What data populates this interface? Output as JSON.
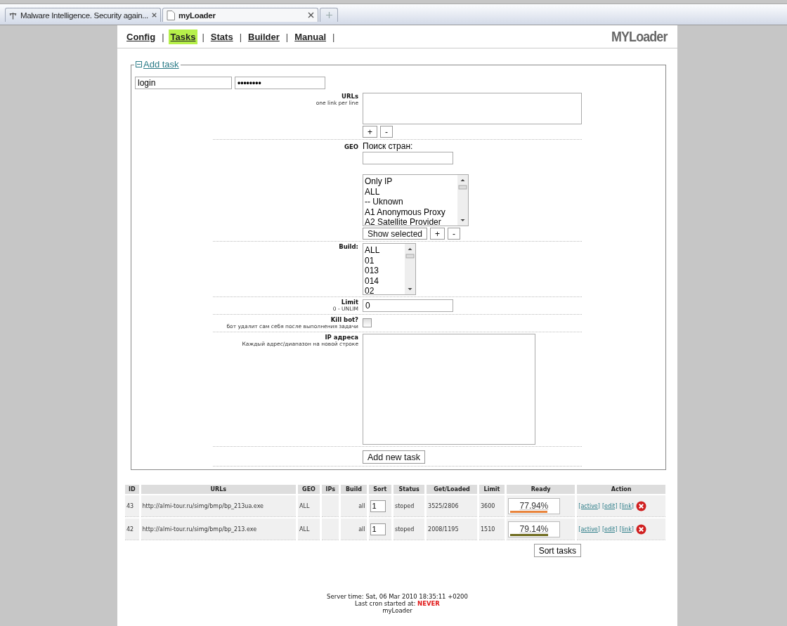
{
  "browser_tabs": [
    {
      "title": "Malware Intelligence. Security again...",
      "selected": false
    },
    {
      "title": "myLoader",
      "selected": true
    }
  ],
  "nav": [
    {
      "label": "Config",
      "selected": false,
      "separator": "|"
    },
    {
      "label": "Tasks",
      "selected": true,
      "separator": "|"
    },
    {
      "label": "Stats",
      "selected": false,
      "separator": "|"
    },
    {
      "label": "Builder",
      "selected": false,
      "separator": "|"
    },
    {
      "label": "Manual",
      "selected": false,
      "separator": "|"
    }
  ],
  "logo": "MYLoader",
  "add_task": {
    "legend": "Add task",
    "expanded": true,
    "login": "login",
    "password": "••••••••",
    "urls": {
      "label": "URLs",
      "hint": "one link per line",
      "buttons": [
        "+",
        "-"
      ]
    },
    "geo": {
      "label": "GEO",
      "search_label": "Поиск стран:",
      "options": [
        "Only IP",
        "ALL",
        "-- Uknown",
        "A1 Anonymous Proxy",
        "A2 Satellite Provider"
      ],
      "buttons": [
        "Show selected",
        "+",
        "-"
      ]
    },
    "build": {
      "label": "Build:",
      "options": [
        "ALL",
        "01",
        "013",
        "014",
        "02"
      ]
    },
    "limit": {
      "label": "Limit",
      "hint": "0 - UNLIM",
      "value": "0"
    },
    "kill_bot": {
      "label": "Kill bot?",
      "hint": "бот удалит сам себя после выполнения задачи",
      "checked": false
    },
    "ip": {
      "label": "IP адреса",
      "hint": "Каждый адрес/диапазон на новой строке"
    },
    "submit": "Add new task"
  },
  "table": {
    "columns": [
      "ID",
      "URLs",
      "GEO",
      "IPs",
      "Build",
      "Sort",
      "Status",
      "Get/Loaded",
      "Limit",
      "Ready",
      "Action"
    ],
    "rows": [
      {
        "id": "43",
        "url": "http://almi-tour.ru/simg/bmp/bp_213ua.exe",
        "geo": "ALL",
        "build": "all",
        "sort": "1",
        "status": "stoped",
        "get_loaded": "3525/2806",
        "limit": "3600",
        "ready": "77.94%",
        "level": 0.7794,
        "color": "#e8843c",
        "actions": [
          "[active]",
          "[edit]",
          "[link]"
        ]
      },
      {
        "id": "42",
        "url": "http://almi-tour.ru/simg/bmp/bp_213.exe",
        "geo": "ALL",
        "build": "all",
        "sort": "1",
        "status": "stoped",
        "get_loaded": "2008/1195",
        "limit": "1510",
        "ready": "79.14%",
        "level": 0.7914,
        "color": "#6e6a1c",
        "actions": [
          "[active]",
          "[edit]",
          "[link]"
        ]
      }
    ],
    "sort_button": "Sort tasks"
  },
  "footer": {
    "server_time": "Server time: Sat, 06 Mar 2010 18:35:11 +0200",
    "cron_label": "Last cron started at:",
    "cron_value": "NEVER",
    "name": "myLoader"
  }
}
